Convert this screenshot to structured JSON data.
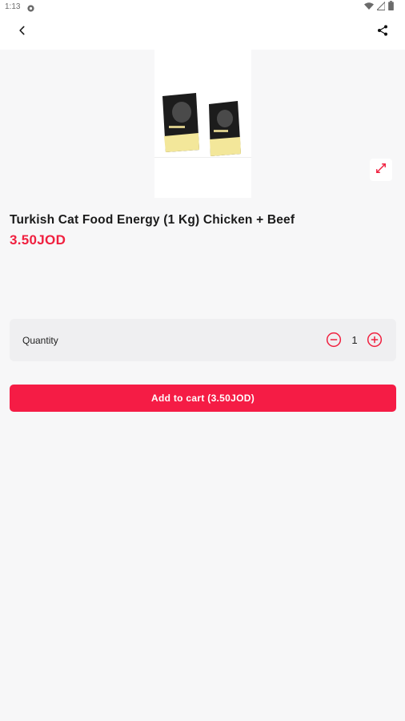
{
  "status_bar": {
    "time": "1:13",
    "icons": [
      "settings-gear-icon",
      "wifi-icon",
      "signal-icon",
      "battery-icon"
    ]
  },
  "appbar": {
    "back_icon": "chevron-left-icon",
    "share_icon": "share-icon"
  },
  "product": {
    "image_alt": "Turkish Cat Food Energy bags",
    "title": "Turkish Cat Food Energy (1 Kg) Chicken + Beef",
    "price": "3.50JOD",
    "expand_icon": "expand-icon"
  },
  "quantity": {
    "label": "Quantity",
    "value": "1",
    "minus_icon": "minus-circle-icon",
    "plus_icon": "plus-circle-icon"
  },
  "cart": {
    "button_label": "Add to cart (3.50JOD)"
  },
  "colors": {
    "accent": "#f51c45",
    "price": "#f0203f",
    "background": "#f7f7f8",
    "card": "#efeff1"
  }
}
